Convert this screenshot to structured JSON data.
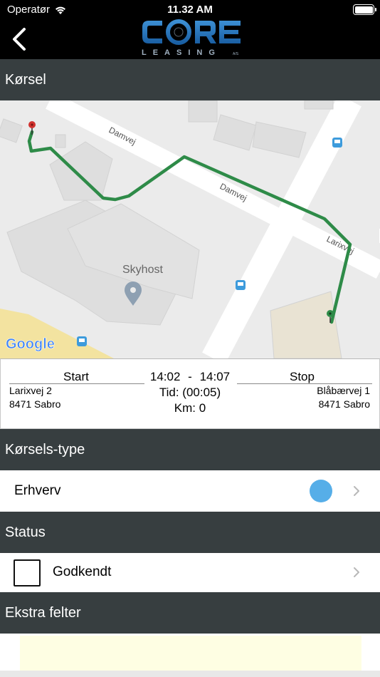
{
  "status_bar": {
    "carrier": "Operatør",
    "time": "11.32 AM"
  },
  "nav": {
    "back_icon": "chevron-left-icon",
    "logo": {
      "word": "CORE",
      "subword": "LEASING",
      "suffix": "A/S"
    }
  },
  "sections": {
    "trip": "Kørsel",
    "trip_type": "Kørsels-type",
    "status": "Status",
    "extra_fields": "Ekstra felter"
  },
  "map": {
    "labels": {
      "street_1": "Damvej",
      "street_2": "Damvej",
      "street_3": "Larixvej",
      "place": "Skyhost"
    },
    "attribution": "Google",
    "route_color": "#2e8b48",
    "start_marker_color": "#d0322f",
    "end_marker_color": "#2e8b48"
  },
  "trip_summary": {
    "start_label": "Start",
    "stop_label": "Stop",
    "start_address_line1": "Larixvej 2",
    "start_address_line2": "8471 Sabro",
    "stop_address_line1": "Blåbærvej 1",
    "stop_address_line2": "8471 Sabro",
    "start_time": "14:02",
    "separator": "-",
    "end_time": "14:07",
    "duration_label": "Tid:",
    "duration_value": "(00:05)",
    "distance_label": "Km:",
    "distance_value": "0"
  },
  "trip_type": {
    "value": "Erhverv",
    "indicator_color": "#56aee8"
  },
  "status": {
    "label": "Godkendt",
    "checked": false
  },
  "colors": {
    "header_bg": "#373e40",
    "extra_field_bg": "#fefee3"
  }
}
